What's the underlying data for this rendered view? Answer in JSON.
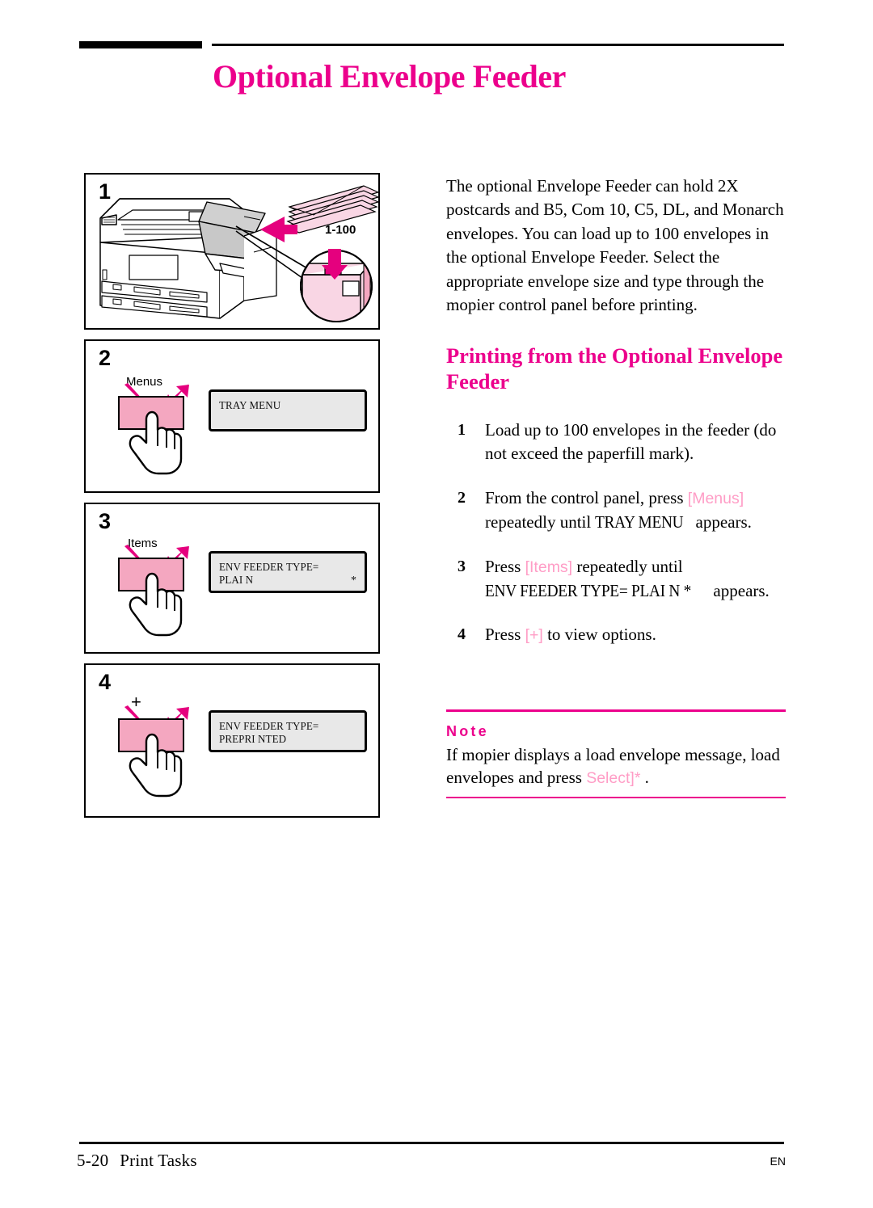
{
  "header": {
    "title": "Optional Envelope Feeder"
  },
  "intro": {
    "paragraph": "The optional Envelope Feeder can hold 2X postcards and B5, Com 10, C5, DL, and Monarch envelopes. You can load up to 100 envelopes in the optional Envelope Feeder. Select the appropriate envelope size and type through the mopier control panel before printing."
  },
  "subhead": {
    "text": "Printing from the Optional Envelope Feeder"
  },
  "steps": [
    {
      "num": "1",
      "parts": [
        {
          "type": "text",
          "text": "Load up to 100 envelopes in the feeder (do not exceed the paperfill mark)."
        }
      ]
    },
    {
      "num": "2",
      "parts": [
        {
          "type": "text",
          "text": "From the control panel, press "
        },
        {
          "type": "key",
          "text": "[Menus]"
        },
        {
          "type": "text",
          "text": " repeatedly until "
        },
        {
          "type": "lcd",
          "text": "TRAY MENU"
        },
        {
          "type": "text",
          "text": " appears."
        }
      ]
    },
    {
      "num": "3",
      "parts": [
        {
          "type": "text",
          "text": "Press "
        },
        {
          "type": "key",
          "text": "[Items]"
        },
        {
          "type": "text",
          "text": " repeatedly until "
        },
        {
          "type": "lcd",
          "text": "ENV FEEDER TYPE= PLAI N *"
        },
        {
          "type": "text",
          "text": " appears."
        }
      ]
    },
    {
      "num": "4",
      "parts": [
        {
          "type": "text",
          "text": "Press "
        },
        {
          "type": "key",
          "text": "[+]"
        },
        {
          "type": "text",
          "text": " to view options."
        }
      ]
    }
  ],
  "note": {
    "heading": "Note",
    "body_before": "If mopier displays a load envelope message, load envelopes and press ",
    "key": "Select]*",
    "body_after": " ."
  },
  "figures": {
    "panel1": {
      "number": "1",
      "capacity_label": "1-100"
    },
    "panel2": {
      "number": "2",
      "key_label": "Menus",
      "lcd_line1": "TRAY MENU",
      "lcd_line2": "",
      "lcd_star": ""
    },
    "panel3": {
      "number": "3",
      "key_label": "Items",
      "lcd_line1": "ENV FEEDER TYPE=",
      "lcd_line2": "PLAI N",
      "lcd_star": "*"
    },
    "panel4": {
      "number": "4",
      "key_label": "+",
      "lcd_line1": "ENV FEEDER TYPE=",
      "lcd_line2": "PREPRI NTED",
      "lcd_star": ""
    }
  },
  "footer": {
    "page_number": "5-20",
    "section": "Print Tasks",
    "language": "EN"
  },
  "colors": {
    "magenta": "#EC008C",
    "pink_key": "#FF9DC6",
    "button_fill": "#F4A7C0",
    "lcd_fill": "#E8E8E8"
  }
}
